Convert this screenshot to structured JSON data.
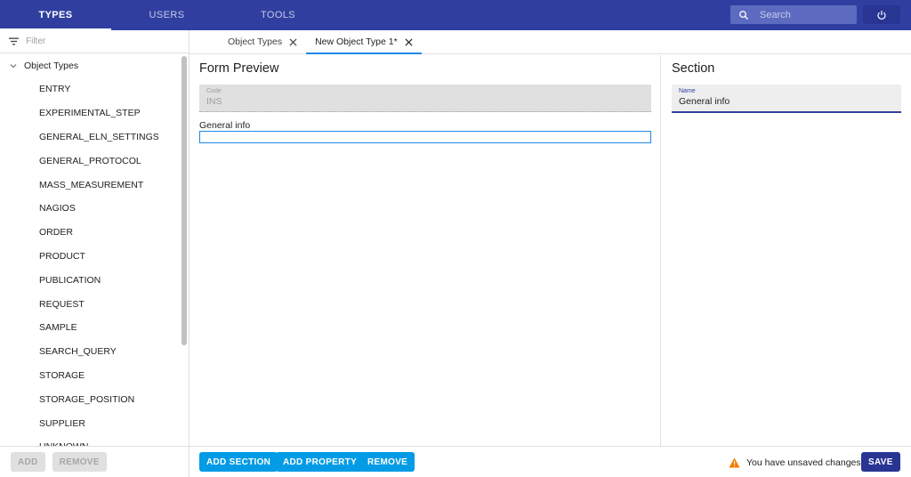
{
  "colors": {
    "appbar": "#303f9f",
    "accent": "#1e88e5",
    "button": "#039be5",
    "save": "#283593",
    "warning": "#f57c00"
  },
  "nav": {
    "tabs": [
      {
        "label": "TYPES",
        "active": true
      },
      {
        "label": "USERS",
        "active": false
      },
      {
        "label": "TOOLS",
        "active": false
      }
    ],
    "search_placeholder": "Search",
    "search_icon": "search-icon",
    "power_icon": "power-icon"
  },
  "sidebar": {
    "filter_placeholder": "Filter",
    "filter_icon": "filter-icon",
    "root_label": "Object Types",
    "items": [
      "ENTRY",
      "EXPERIMENTAL_STEP",
      "GENERAL_ELN_SETTINGS",
      "GENERAL_PROTOCOL",
      "MASS_MEASUREMENT",
      "NAGIOS",
      "ORDER",
      "PRODUCT",
      "PUBLICATION",
      "REQUEST",
      "SAMPLE",
      "SEARCH_QUERY",
      "STORAGE",
      "STORAGE_POSITION",
      "SUPPLIER",
      "UNKNOWN"
    ],
    "add_label": "ADD",
    "remove_label": "REMOVE"
  },
  "doc_tabs": [
    {
      "label": "Object Types",
      "active": false
    },
    {
      "label": "New Object Type 1*",
      "active": true
    }
  ],
  "preview": {
    "title": "Form Preview",
    "code_label": "Code",
    "code_value": "INS",
    "section_name": "General info"
  },
  "section_panel": {
    "title": "Section",
    "name_label": "Name",
    "name_value": "General info"
  },
  "footer": {
    "add_section": "ADD SECTION",
    "add_property": "ADD PROPERTY",
    "remove": "REMOVE",
    "warning_text": "You have unsaved changes",
    "save": "SAVE"
  }
}
